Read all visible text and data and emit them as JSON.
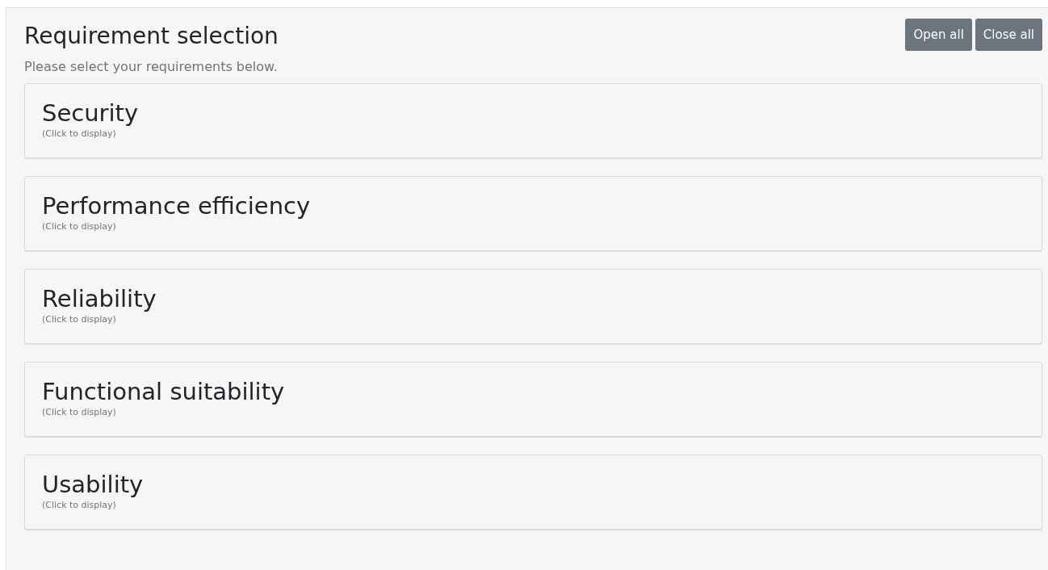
{
  "header": {
    "title": "Requirement selection",
    "subtitle": "Please select your requirements below."
  },
  "buttons": [
    {
      "label": "Open all"
    },
    {
      "label": "Close all"
    }
  ],
  "sections": [
    {
      "title": "Security",
      "hint": "(Click to display)"
    },
    {
      "title": "Performance efficiency",
      "hint": "(Click to display)"
    },
    {
      "title": "Reliability",
      "hint": "(Click to display)"
    },
    {
      "title": "Functional suitability",
      "hint": "(Click to display)"
    },
    {
      "title": "Usability",
      "hint": "(Click to display)"
    }
  ]
}
